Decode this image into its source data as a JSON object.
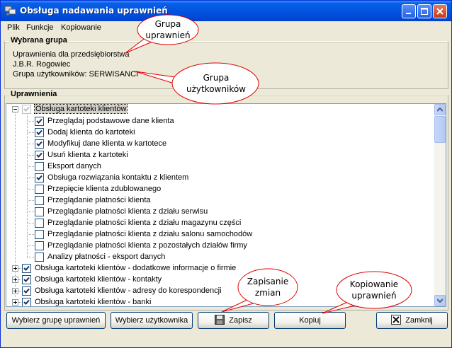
{
  "window": {
    "title": "Obsługa nadawania uprawnień",
    "controls": [
      "minimize-icon",
      "maximize-icon",
      "close-icon"
    ]
  },
  "menu": [
    "Plik",
    "Funkcje",
    "Kopiowanie"
  ],
  "selected_group": {
    "legend": "Wybrana grupa",
    "line1": "Uprawnienia dla przedsiębiorstwa",
    "line2": "J.B.R. Rogowiec",
    "line3": "Grupa użytkowników: SERWISANCI"
  },
  "permissions": {
    "legend": "Uprawnienia",
    "root": {
      "label": "Obsługa kartoteki klientów",
      "checked": true,
      "expanded": true
    },
    "children": [
      {
        "label": "Przeglądaj podstawowe dane klienta",
        "checked": true
      },
      {
        "label": "Dodaj klienta do kartoteki",
        "checked": true
      },
      {
        "label": "Modyfikuj dane klienta w kartotece",
        "checked": true
      },
      {
        "label": "Usuń klienta z kartoteki",
        "checked": true
      },
      {
        "label": "Eksport danych",
        "checked": false
      },
      {
        "label": "Obsługa rozwiązania kontaktu z klientem",
        "checked": true
      },
      {
        "label": "Przepięcie klienta zdublowanego",
        "checked": false
      },
      {
        "label": "Przeglądanie płatności klienta",
        "checked": false
      },
      {
        "label": "Przeglądanie płatności klienta z działu serwisu",
        "checked": false
      },
      {
        "label": "Przeglądanie płatności klienta z działu magazynu części",
        "checked": false
      },
      {
        "label": "Przeglądanie płatności klienta z działu salonu samochodów",
        "checked": false
      },
      {
        "label": "Przeglądanie płatności klienta z pozostałych działów firmy",
        "checked": false
      },
      {
        "label": "Analizy płatności - eksport danych",
        "checked": false
      }
    ],
    "siblings": [
      {
        "label": "Obsługa kartoteki klientów - dodatkowe informacje o firmie",
        "checked": true
      },
      {
        "label": "Obsługa kartoteki klientów - kontakty",
        "checked": true
      },
      {
        "label": "Obsługa kartoteki klientów - adresy do korespondencji",
        "checked": true
      },
      {
        "label": "Obsługa kartoteki klientów - banki",
        "checked": true
      }
    ]
  },
  "buttons": {
    "choose_group": "Wybierz grupę uprawnień",
    "choose_user": "Wybierz użytkownika",
    "save": "Zapisz",
    "copy": "Kopiuj",
    "close": "Zamknij"
  },
  "callouts": {
    "group_l1": "Grupa",
    "group_l2": "uprawnień",
    "users_l1": "Grupa",
    "users_l2": "użytkowników",
    "save_l1": "Zapisanie",
    "save_l2": "zmian",
    "copy_l1": "Kopiowanie",
    "copy_l2": "uprawnień"
  }
}
